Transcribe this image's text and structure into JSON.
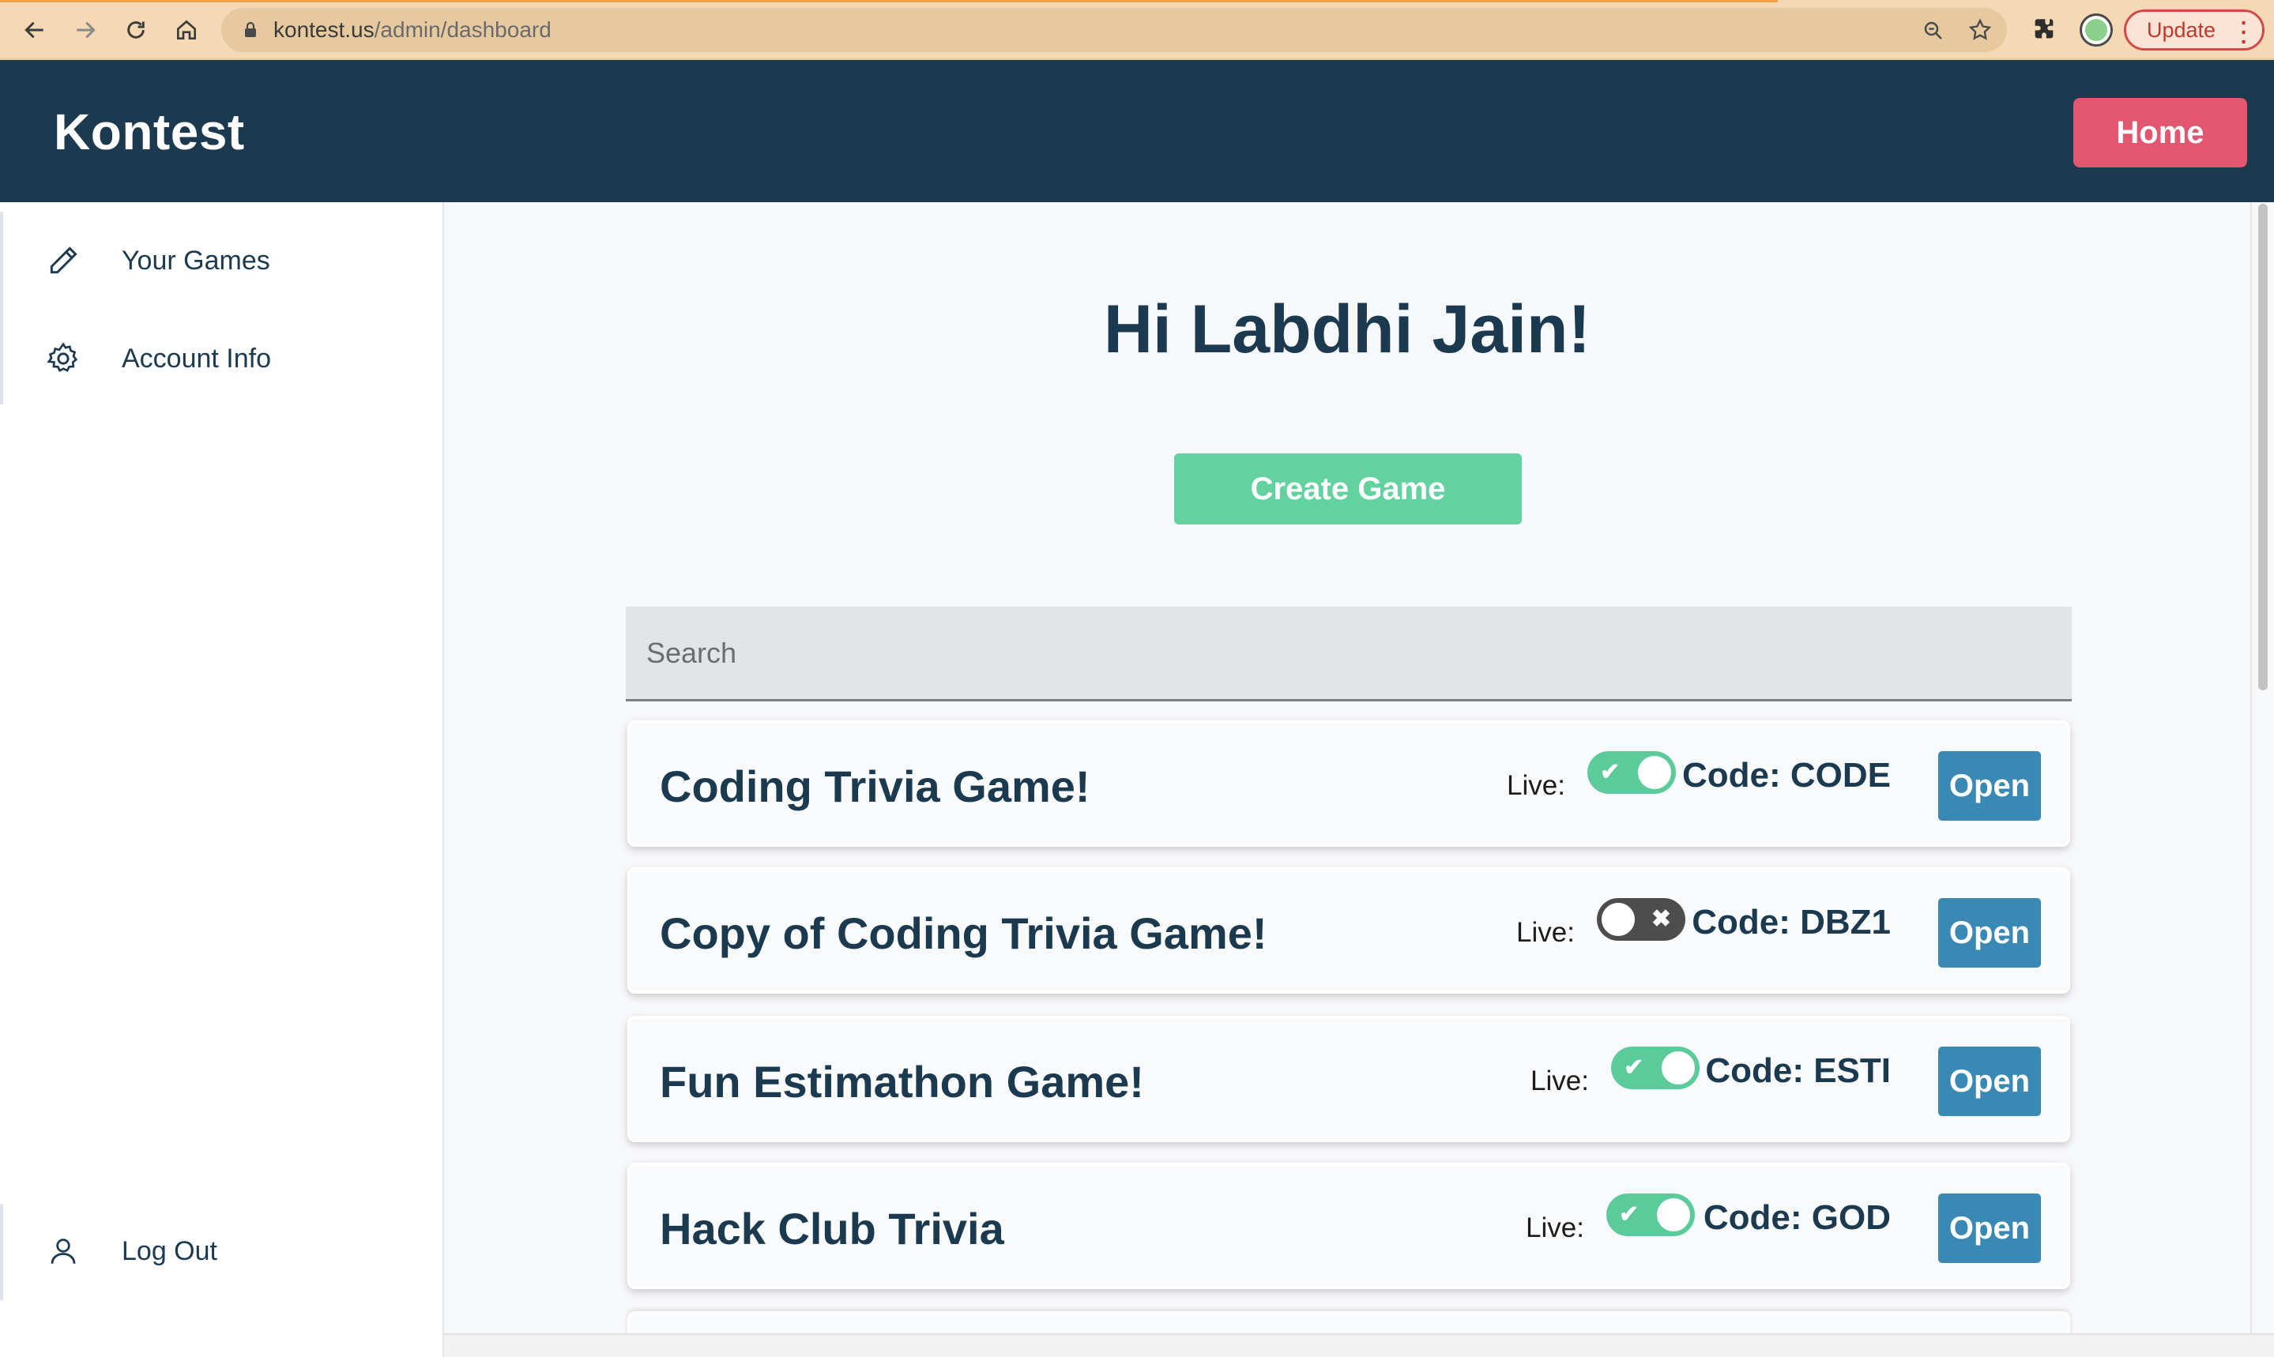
{
  "browser": {
    "url_host": "kontest.us",
    "url_path": "/admin/dashboard",
    "update_label": "Update"
  },
  "header": {
    "brand": "Kontest",
    "home_label": "Home"
  },
  "sidebar": {
    "items": [
      {
        "label": "Your Games",
        "icon": "pencil-icon"
      },
      {
        "label": "Account Info",
        "icon": "gear-icon"
      }
    ],
    "logout": {
      "label": "Log Out",
      "icon": "user-icon"
    }
  },
  "main": {
    "greeting": "Hi Labdhi Jain!",
    "create_label": "Create Game",
    "search_placeholder": "Search",
    "live_label": "Live:",
    "open_label": "Open",
    "games": [
      {
        "title": "Coding Trivia Game!",
        "live": true,
        "code": "Code: CODE"
      },
      {
        "title": "Copy of Coding Trivia Game!",
        "live": false,
        "code": "Code: DBZ1"
      },
      {
        "title": "Fun Estimathon Game!",
        "live": true,
        "code": "Code: ESTI"
      },
      {
        "title": "Hack Club Trivia",
        "live": true,
        "code": "Code: GOD"
      }
    ]
  },
  "colors": {
    "header_bg": "#1c3a4f",
    "home_button": "#e2566f",
    "create_button": "#63d1a0",
    "open_button": "#3a88b4",
    "toggle_on": "#5bcb9c",
    "toggle_off": "#4d4d4d"
  }
}
